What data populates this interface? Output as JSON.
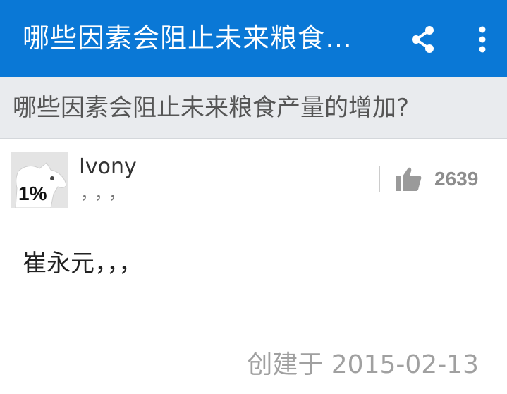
{
  "appbar": {
    "title": "哪些因素会阻止未来粮食…",
    "share_icon": "share-icon",
    "more_icon": "more-vert-icon",
    "color": "#0a78d6"
  },
  "question": {
    "text": "哪些因素会阻止未来粮食产量的增加?"
  },
  "answer": {
    "author": {
      "name": "Ivony",
      "bio": "，，，",
      "avatar_badge": "1%"
    },
    "votes": {
      "count": "2639",
      "icon": "thumb-up-icon"
    },
    "body": "崔永元，，，",
    "created": "创建于 2015-02-13"
  }
}
